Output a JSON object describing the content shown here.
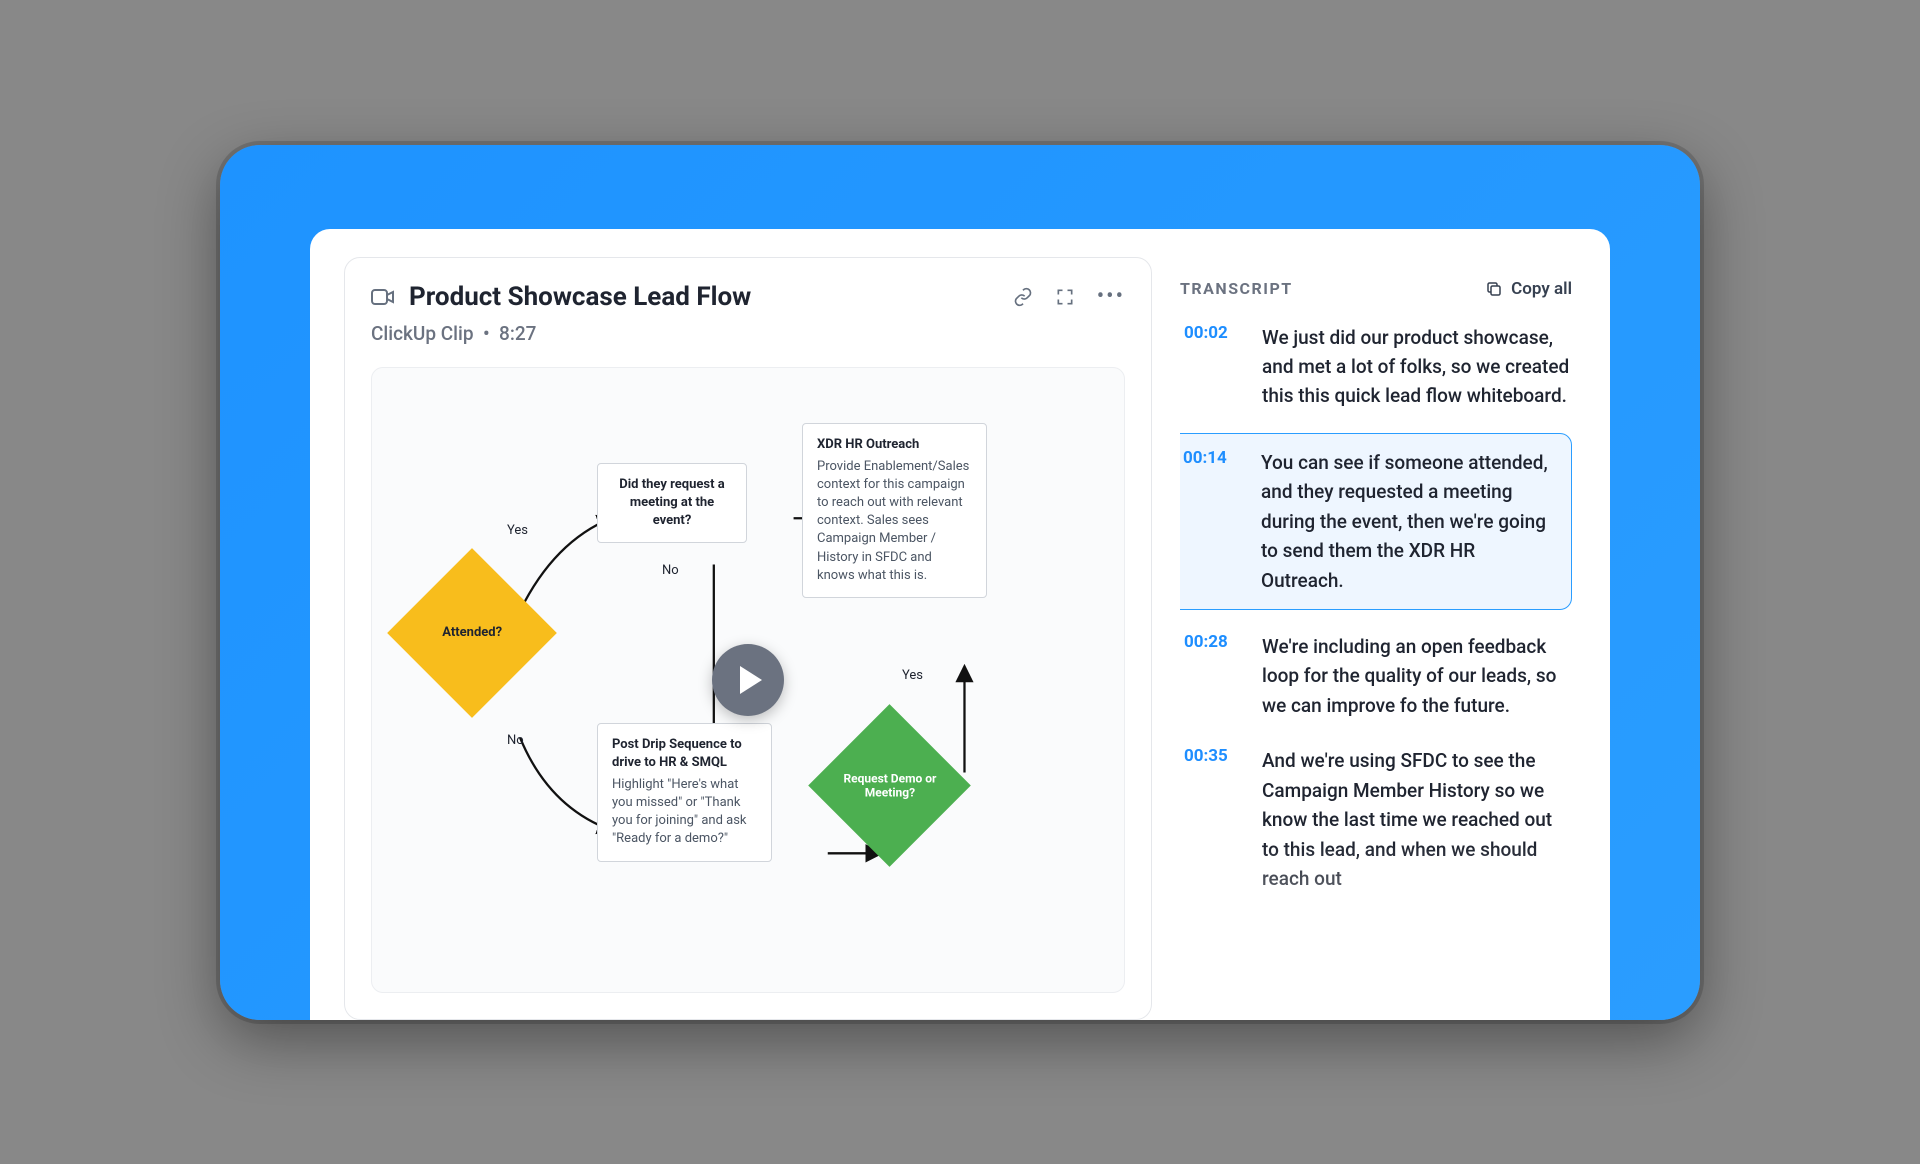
{
  "clip": {
    "title": "Product Showcase Lead Flow",
    "source": "ClickUp Clip",
    "duration": "8:27"
  },
  "flow": {
    "attended_label": "Attended?",
    "attended_yes": "Yes",
    "attended_no": "No",
    "meeting_box_head": "Did they request a meeting at the event?",
    "meeting_no": "No",
    "outreach_head": "XDR HR Outreach",
    "outreach_body": "Provide Enablement/Sales context for this campaign to reach out with relevant context. Sales sees Campaign Member / History in SFDC and knows what this is.",
    "drip_head": "Post Drip Sequence to drive to HR & SMQL",
    "drip_body": "Highlight \"Here's what you missed\" or \"Thank you for joining\" and ask \"Ready for a demo?\"",
    "demo_label": "Request Demo or Meeting?",
    "demo_yes": "Yes"
  },
  "transcript": {
    "header": "TRANSCRIPT",
    "copy_label": "Copy all",
    "items": [
      {
        "time": "00:02",
        "text": "We just did our product showcase, and met a lot of folks, so we created this this quick lead flow whiteboard.",
        "active": false
      },
      {
        "time": "00:14",
        "text": "You can see if someone attended, and they requested a meeting during the event, then we're going to send them the XDR HR Outreach.",
        "active": true
      },
      {
        "time": "00:28",
        "text": "We're including an open feedback loop for the quality of our leads, so we can improve fo the future.",
        "active": false
      },
      {
        "time": "00:35",
        "text": "And we're using SFDC to see the Campaign Member History so we know the last time we reached out to this lead, and when we should reach out",
        "active": false
      }
    ]
  }
}
